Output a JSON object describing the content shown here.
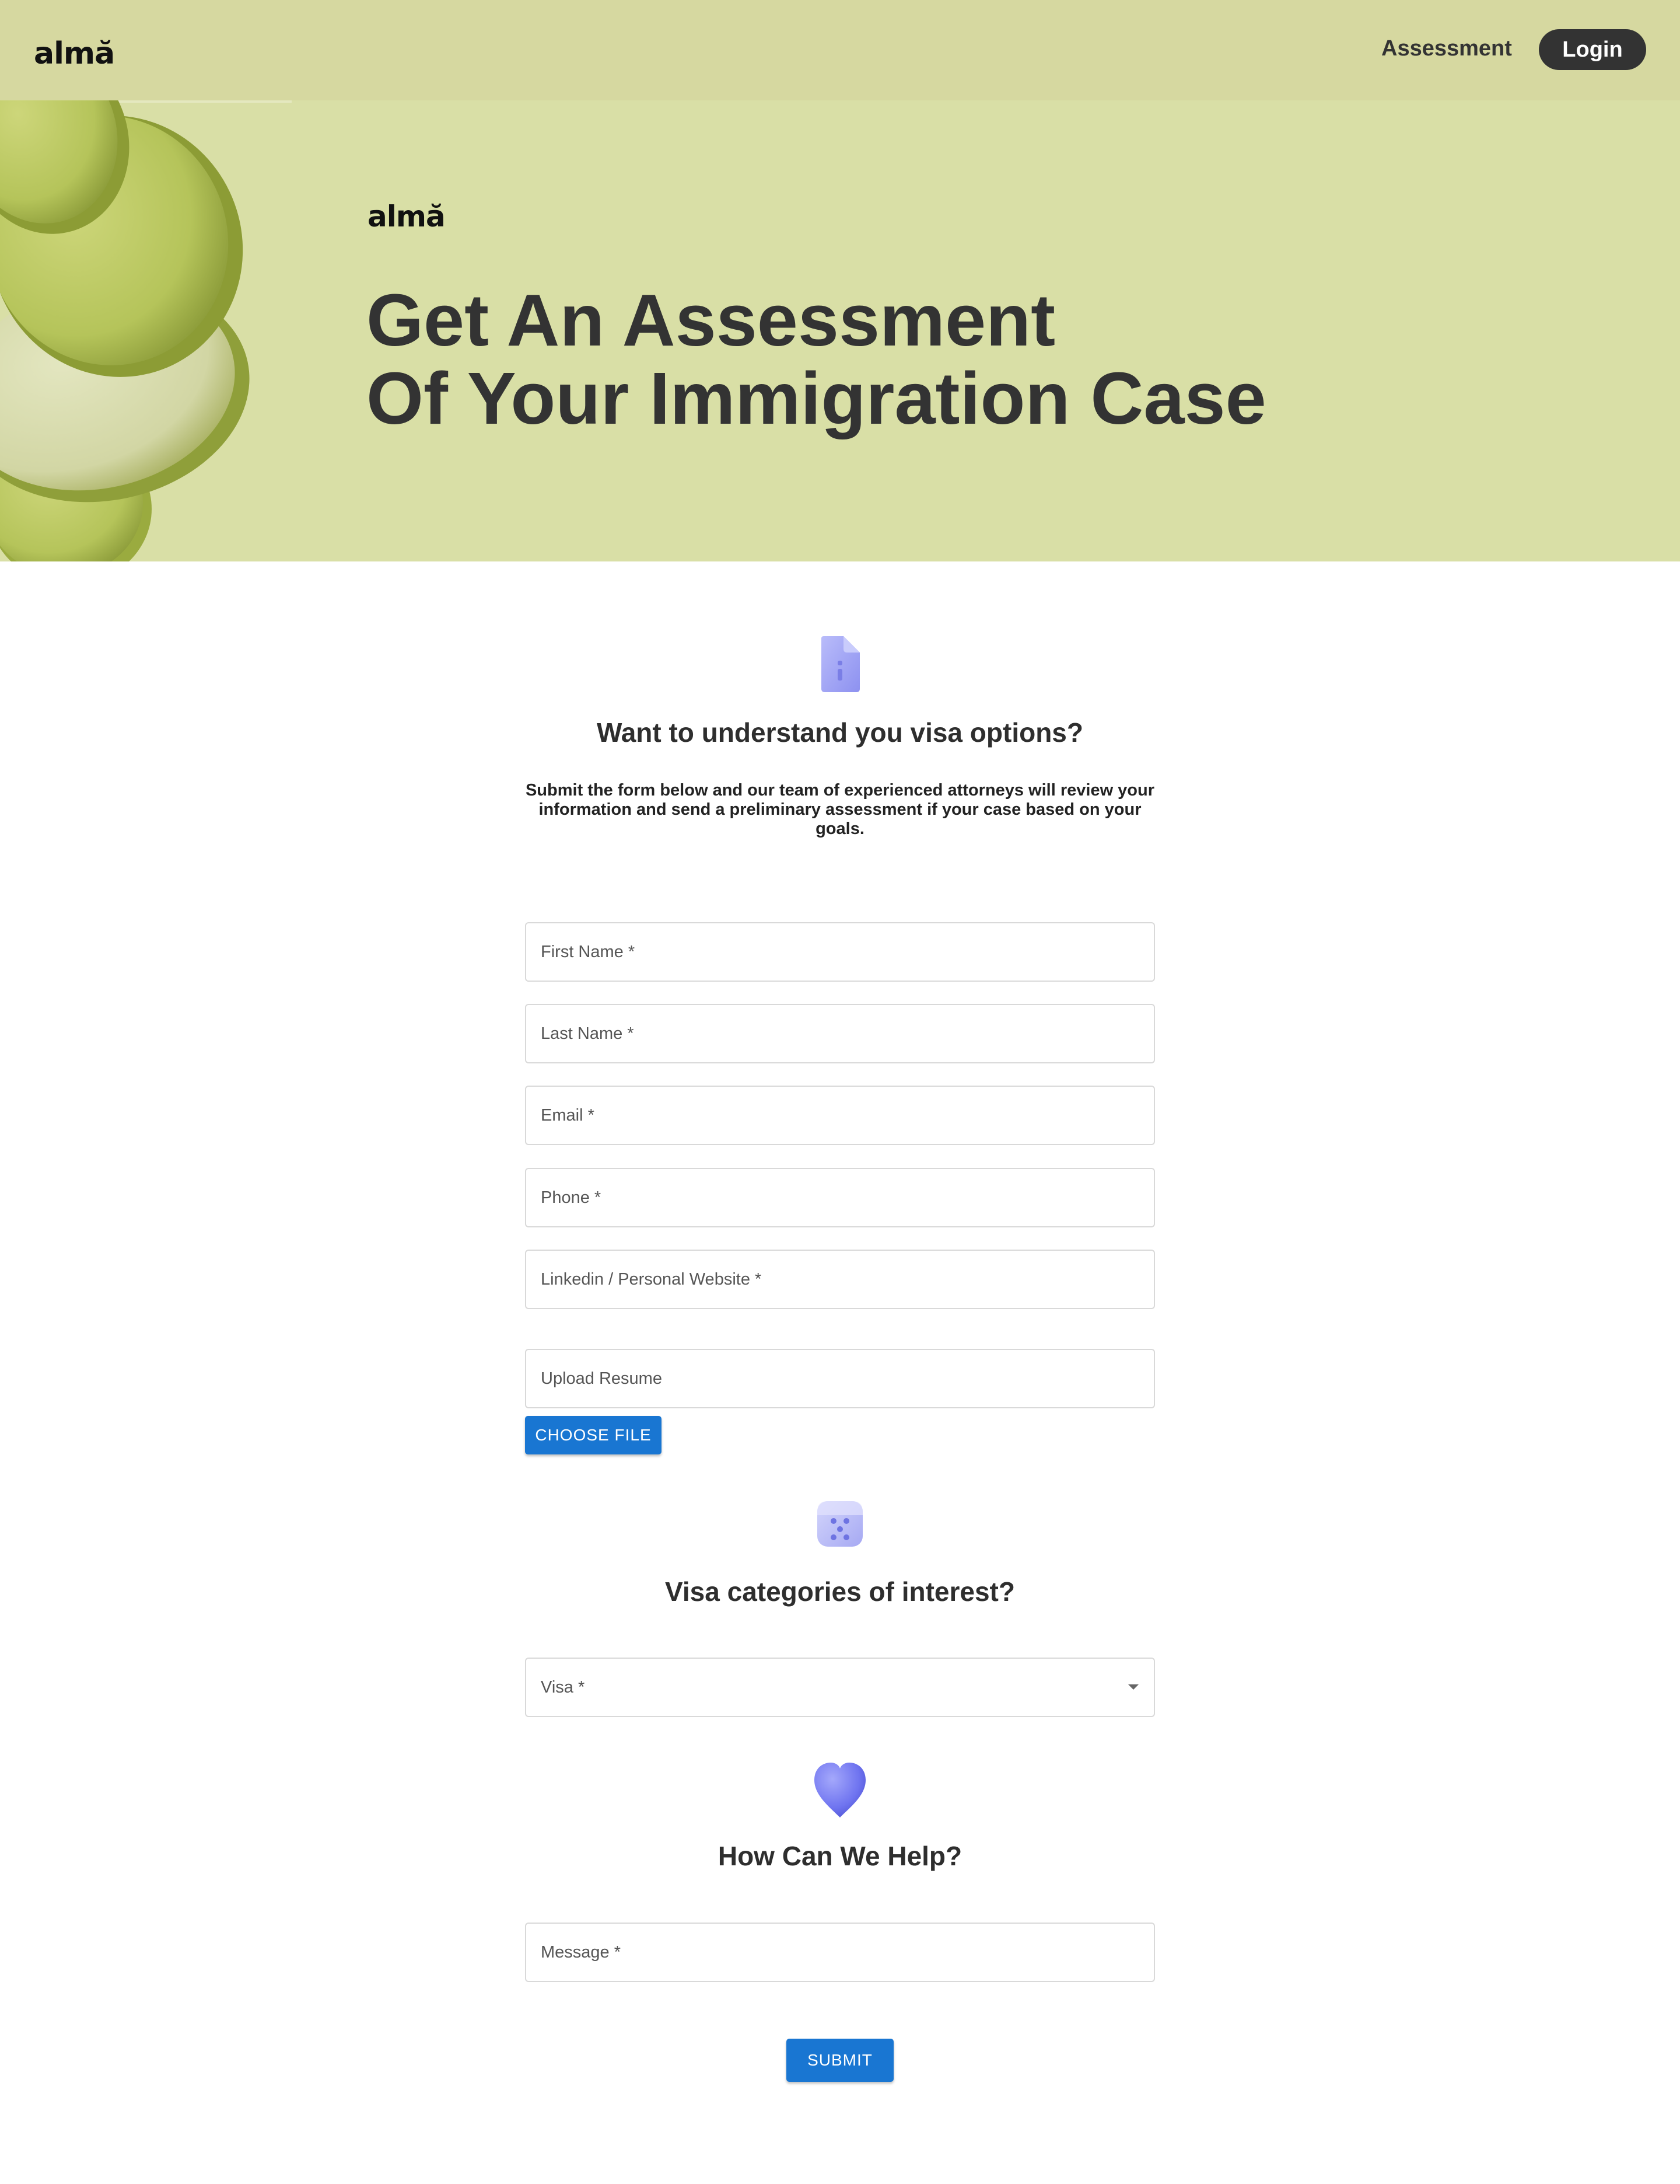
{
  "navbar": {
    "logo": "almă",
    "assessment_link": "Assessment",
    "login_button": "Login"
  },
  "hero": {
    "logo": "almă",
    "title_line1": "Get An Assessment",
    "title_line2": "Of Your Immigration Case"
  },
  "intro_section": {
    "icon": "document-icon",
    "heading": "Want to understand you visa options?",
    "description": "Submit the form below and our team of experienced attorneys will review your information and send a preliminary assessment if your case based on your goals."
  },
  "form": {
    "first_name_placeholder": "First Name *",
    "last_name_placeholder": "Last Name *",
    "email_placeholder": "Email *",
    "phone_placeholder": "Phone *",
    "website_placeholder": "Linkedin / Personal Website *",
    "resume_placeholder": "Upload Resume",
    "choose_file_button": "CHOOSE FILE"
  },
  "visa_section": {
    "icon": "dice-icon",
    "heading": "Visa categories of interest?",
    "select_label": "Visa *"
  },
  "help_section": {
    "icon": "heart-icon",
    "heading": "How Can We Help?",
    "message_placeholder": "Message *",
    "submit_button": "SUBMIT"
  },
  "colors": {
    "navbar_bg": "#d6d8a0",
    "hero_bg": "#d9dfa6",
    "primary_button": "#1976d2",
    "dark_button": "#333333",
    "icon_purple": "#7b7ff0"
  }
}
